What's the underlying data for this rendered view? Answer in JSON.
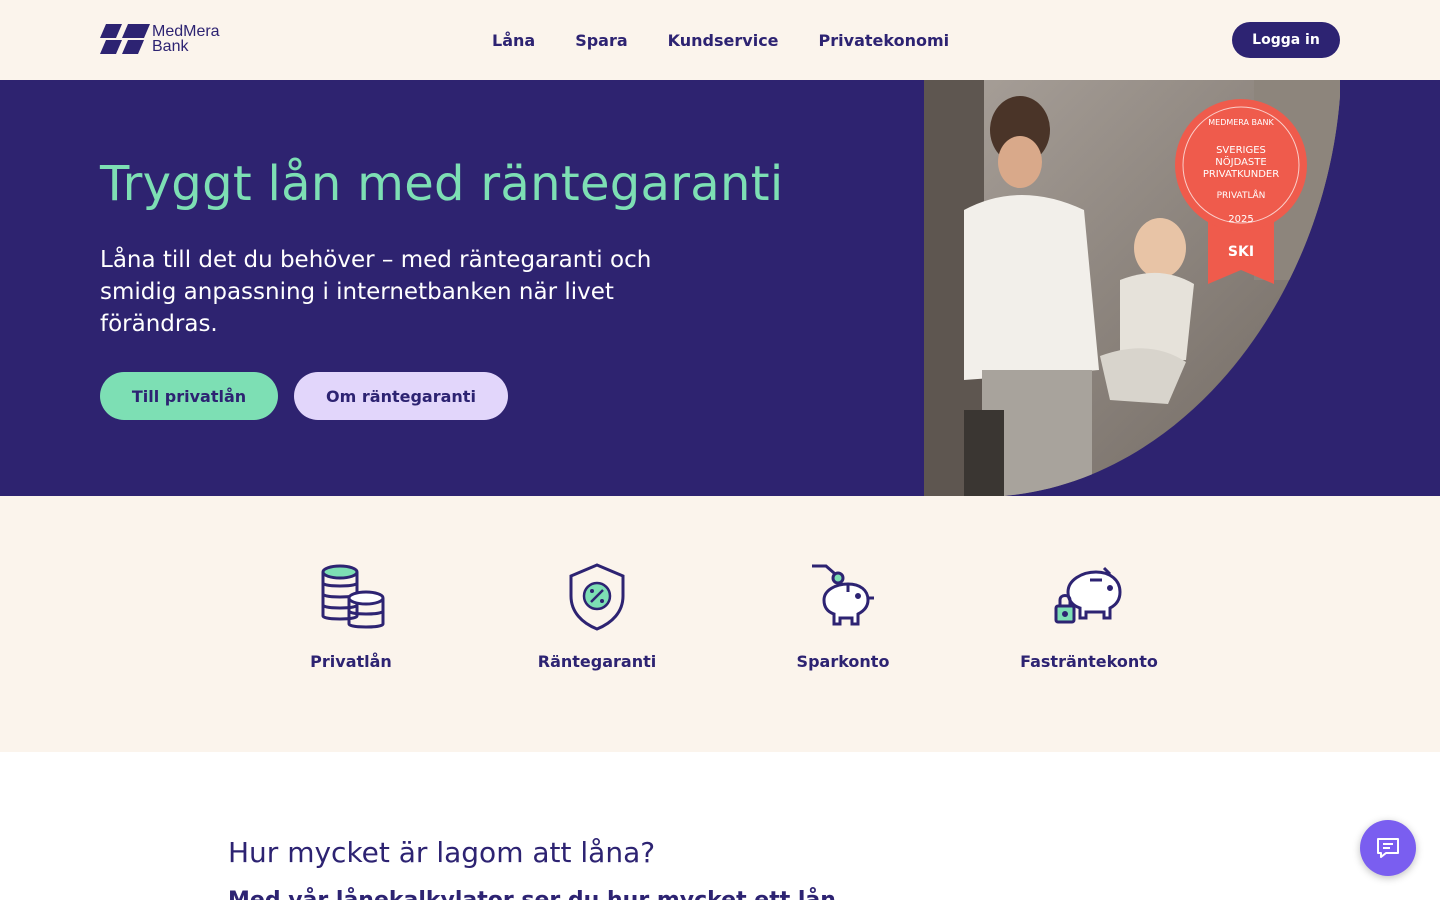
{
  "brand": {
    "line1": "MedMera",
    "line2": "Bank"
  },
  "nav": {
    "items": [
      "Låna",
      "Spara",
      "Kundservice",
      "Privatekonomi"
    ]
  },
  "header": {
    "login_label": "Logga in"
  },
  "hero": {
    "title": "Tryggt lån med räntegaranti",
    "text": "Låna till det du behöver – med räntegaranti och smidig anpassning i internetbanken när livet förändras.",
    "primary_cta": "Till privatlån",
    "secondary_cta": "Om räntegaranti",
    "badge": {
      "brand": "MEDMERA BANK",
      "line1": "SVERIGES",
      "line2": "NÖJDASTE",
      "line3": "PRIVATKUNDER",
      "category": "PRIVATLÅN",
      "year": "2025",
      "source": "SKI"
    }
  },
  "products": [
    {
      "label": "Privatlån",
      "icon": "coins-icon"
    },
    {
      "label": "Räntegaranti",
      "icon": "shield-percent-icon"
    },
    {
      "label": "Sparkonto",
      "icon": "piggy-bank-coin-icon"
    },
    {
      "label": "Fasträntekonto",
      "icon": "piggy-bank-lock-icon"
    }
  ],
  "section": {
    "title": "Hur mycket är lagom att låna?",
    "subtitle": "Med vår lånekalkylator ser du hur mycket ett lån"
  },
  "chat": {
    "icon": "chat-icon"
  },
  "colors": {
    "primary": "#2d2372",
    "accent_green": "#7ddfb4",
    "accent_lilac": "#e2d6fb",
    "cream": "#fbf4ec",
    "chat": "#7a5ef0",
    "badge": "#ef5b4c"
  }
}
